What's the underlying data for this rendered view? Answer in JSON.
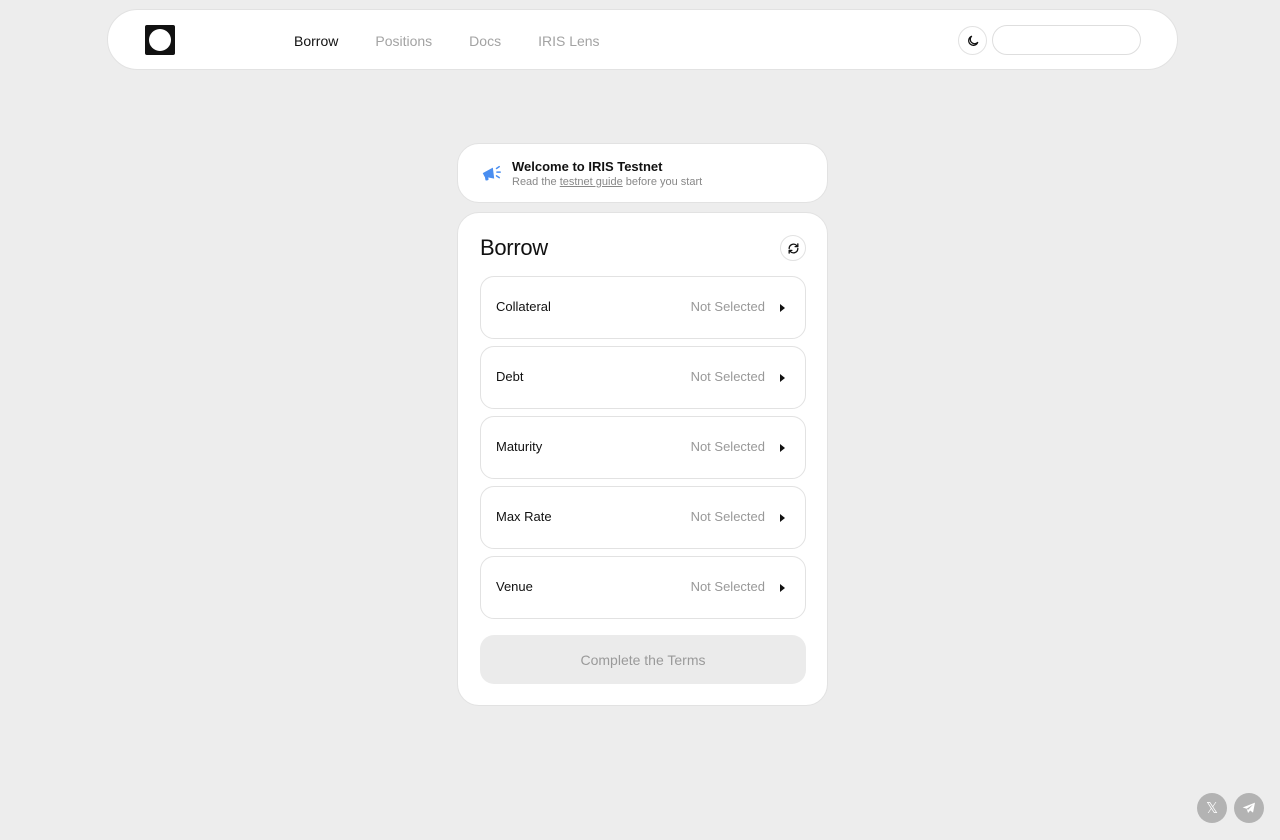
{
  "nav": {
    "links": [
      {
        "label": "Borrow",
        "active": true
      },
      {
        "label": "Positions",
        "active": false
      },
      {
        "label": "Docs",
        "active": false
      },
      {
        "label": "IRIS Lens",
        "active": false
      }
    ],
    "theme_icon": "moon-icon",
    "wallet_label": ""
  },
  "banner": {
    "icon": "megaphone-icon",
    "title": "Welcome to IRIS Testnet",
    "sub_prefix": "Read the ",
    "sub_link": "testnet guide",
    "sub_suffix": " before you start"
  },
  "borrow": {
    "title": "Borrow",
    "refresh_icon": "refresh-icon",
    "rows": [
      {
        "label": "Collateral",
        "value": "Not Selected"
      },
      {
        "label": "Debt",
        "value": "Not Selected"
      },
      {
        "label": "Maturity",
        "value": "Not Selected"
      },
      {
        "label": "Max Rate",
        "value": "Not Selected"
      },
      {
        "label": "Venue",
        "value": "Not Selected"
      }
    ],
    "cta_label": "Complete the Terms"
  },
  "social": {
    "x_glyph": "𝕏",
    "telegram_icon": "telegram-icon"
  },
  "colors": {
    "background": "#ededed",
    "accent_blue": "#4a8ef0",
    "muted_text": "#999999"
  }
}
